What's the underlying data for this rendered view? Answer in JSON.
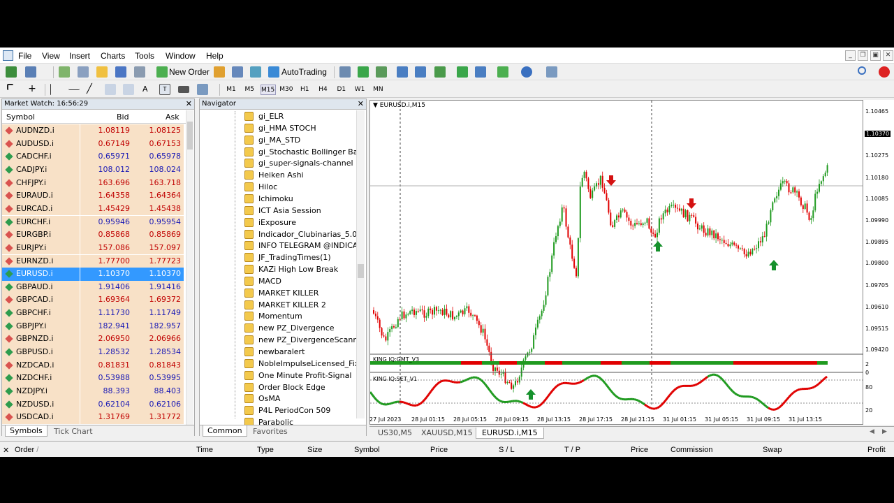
{
  "menu": [
    "File",
    "View",
    "Insert",
    "Charts",
    "Tools",
    "Window",
    "Help"
  ],
  "toolbar": {
    "new_order": "New Order",
    "autotrading": "AutoTrading"
  },
  "timeframes": [
    "M1",
    "M5",
    "M15",
    "M30",
    "H1",
    "H4",
    "D1",
    "W1",
    "MN"
  ],
  "active_timeframe": "M15",
  "market_watch": {
    "title": "Market Watch: 16:56:29",
    "col_symbol": "Symbol",
    "col_bid": "Bid",
    "col_ask": "Ask",
    "rows": [
      {
        "s": "AUDNZD.i",
        "b": "1.08119",
        "a": "1.08125",
        "d": "down"
      },
      {
        "s": "AUDUSD.i",
        "b": "0.67149",
        "a": "0.67153",
        "d": "down"
      },
      {
        "s": "CADCHF.i",
        "b": "0.65971",
        "a": "0.65978",
        "d": "up"
      },
      {
        "s": "CADJPY.i",
        "b": "108.012",
        "a": "108.024",
        "d": "up"
      },
      {
        "s": "CHFJPY.i",
        "b": "163.696",
        "a": "163.718",
        "d": "down"
      },
      {
        "s": "EURAUD.i",
        "b": "1.64358",
        "a": "1.64364",
        "d": "down"
      },
      {
        "s": "EURCAD.i",
        "b": "1.45429",
        "a": "1.45438",
        "d": "down"
      },
      {
        "s": "EURCHF.i",
        "b": "0.95946",
        "a": "0.95954",
        "d": "up"
      },
      {
        "s": "EURGBP.i",
        "b": "0.85868",
        "a": "0.85869",
        "d": "down"
      },
      {
        "s": "EURJPY.i",
        "b": "157.086",
        "a": "157.097",
        "d": "down"
      },
      {
        "s": "EURNZD.i",
        "b": "1.77700",
        "a": "1.77723",
        "d": "down"
      },
      {
        "s": "EURUSD.i",
        "b": "1.10370",
        "a": "1.10370",
        "d": "up",
        "sel": true
      },
      {
        "s": "GBPAUD.i",
        "b": "1.91406",
        "a": "1.91416",
        "d": "up"
      },
      {
        "s": "GBPCAD.i",
        "b": "1.69364",
        "a": "1.69372",
        "d": "down"
      },
      {
        "s": "GBPCHF.i",
        "b": "1.11730",
        "a": "1.11749",
        "d": "up"
      },
      {
        "s": "GBPJPY.i",
        "b": "182.941",
        "a": "182.957",
        "d": "up"
      },
      {
        "s": "GBPNZD.i",
        "b": "2.06950",
        "a": "2.06966",
        "d": "down"
      },
      {
        "s": "GBPUSD.i",
        "b": "1.28532",
        "a": "1.28534",
        "d": "up"
      },
      {
        "s": "NZDCAD.i",
        "b": "0.81831",
        "a": "0.81843",
        "d": "down"
      },
      {
        "s": "NZDCHF.i",
        "b": "0.53988",
        "a": "0.53995",
        "d": "up"
      },
      {
        "s": "NZDJPY.i",
        "b": "88.393",
        "a": "88.403",
        "d": "up"
      },
      {
        "s": "NZDUSD.i",
        "b": "0.62104",
        "a": "0.62106",
        "d": "up"
      },
      {
        "s": "USDCAD.i",
        "b": "1.31769",
        "a": "1.31772",
        "d": "down"
      }
    ],
    "tabs": [
      "Symbols",
      "Tick Chart"
    ]
  },
  "navigator": {
    "title": "Navigator",
    "items": [
      "gi_ELR",
      "gi_HMA STOCH",
      "gi_MA_STD",
      "gi_Stochastic Bollinger Banc",
      "gi_super-signals-channel",
      "Heiken Ashi",
      "Hiloc",
      "Ichimoku",
      "ICT Asia Session",
      "iExposure",
      "Indicador_Clubinarias_5.0",
      "INFO TELEGRAM @INDICAL",
      "JF_TradingTimes(1)",
      "KAZi High Low Break",
      "MACD",
      "MARKET KILLER",
      "MARKET KILLER 2",
      "Momentum",
      "new PZ_Divergence",
      "new PZ_DivergenceScanner",
      "newbaralert",
      "NobleImpulseLicensed_Fix",
      "One Minute Profit-Signal",
      "Order Block Edge",
      "OsMA",
      "P4L PeriodCon 509",
      "Parabolic"
    ],
    "tabs": [
      "Common",
      "Favorites"
    ]
  },
  "chart": {
    "title": "EURUSD.i,M15",
    "price_labels": [
      "1.10465",
      "1.10370",
      "1.10275",
      "1.10180",
      "1.10085",
      "1.09990",
      "1.09895",
      "1.09800",
      "1.09705",
      "1.09610",
      "1.09515",
      "1.09420"
    ],
    "current_price": "1.10370",
    "time_labels": [
      "27 Jul 2023",
      "28 Jul 01:15",
      "28 Jul 05:15",
      "28 Jul 09:15",
      "28 Jul 13:15",
      "28 Jul 17:15",
      "28 Jul 21:15",
      "31 Jul 01:15",
      "31 Jul 05:15",
      "31 Jul 09:15",
      "31 Jul 13:15"
    ],
    "ind1_name": "KING IQ:GMT_V3",
    "ind1_scale": [
      "2",
      "0"
    ],
    "ind2_name": "KING IQ:SET_V1",
    "ind2_scale": [
      "80",
      "20"
    ],
    "colors": {
      "bull": "#1f9a1f",
      "bear": "#e00000",
      "signal_up": "#16912c",
      "signal_down": "#d41111"
    }
  },
  "chart_tabs": [
    "US30,M5",
    "XAUUSD,M15",
    "EURUSD.i,M15"
  ],
  "active_chart_tab": "EURUSD.i,M15",
  "terminal_columns": [
    "Order",
    "Time",
    "Type",
    "Size",
    "Symbol",
    "Price",
    "S / L",
    "T / P",
    "Price",
    "Commission",
    "Swap",
    "Profit"
  ]
}
